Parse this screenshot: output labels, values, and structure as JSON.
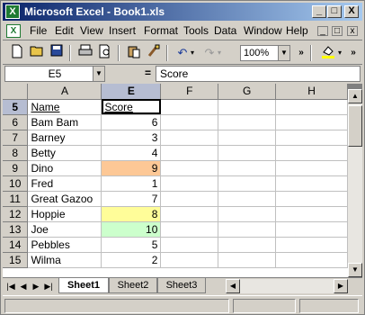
{
  "window": {
    "title": "Microsoft Excel - Book1.xls",
    "app_icon": "X",
    "controls": {
      "minimize": "_",
      "restore": "□",
      "close": "X"
    }
  },
  "menubar": {
    "items": [
      {
        "label": "File"
      },
      {
        "label": "Edit"
      },
      {
        "label": "View"
      },
      {
        "label": "Insert"
      },
      {
        "label": "Format"
      },
      {
        "label": "Tools"
      },
      {
        "label": "Data"
      },
      {
        "label": "Window"
      },
      {
        "label": "Help"
      }
    ]
  },
  "toolbar": {
    "zoom": "100%",
    "icons": [
      "new-document-icon",
      "open-folder-icon",
      "save-disk-icon",
      "print-icon",
      "print-preview-icon",
      "paste-icon",
      "format-painter-icon",
      "undo-icon",
      "redo-icon",
      "fill-color-icon"
    ]
  },
  "formula_bar": {
    "name_box": "E5",
    "equals": "=",
    "content": "Score"
  },
  "grid": {
    "columns": [
      "A",
      "E",
      "F",
      "G",
      "H"
    ],
    "rows": [
      {
        "num": "5",
        "name": "Name",
        "score": "Score",
        "header": true
      },
      {
        "num": "6",
        "name": "Bam Bam",
        "score": "6"
      },
      {
        "num": "7",
        "name": "Barney",
        "score": "3"
      },
      {
        "num": "8",
        "name": "Betty",
        "score": "4"
      },
      {
        "num": "9",
        "name": "Dino",
        "score": "9",
        "fill": "#fdc896"
      },
      {
        "num": "10",
        "name": "Fred",
        "score": "1"
      },
      {
        "num": "11",
        "name": "Great Gazoo",
        "score": "7"
      },
      {
        "num": "12",
        "name": "Hoppie",
        "score": "8",
        "fill": "#fffd99"
      },
      {
        "num": "13",
        "name": "Joe",
        "score": "10",
        "fill": "#ccffcc"
      },
      {
        "num": "14",
        "name": "Pebbles",
        "score": "5"
      },
      {
        "num": "15",
        "name": "Wilma",
        "score": "2"
      }
    ]
  },
  "sheets": {
    "tabs": [
      {
        "label": "Sheet1",
        "active": true
      },
      {
        "label": "Sheet2",
        "active": false
      },
      {
        "label": "Sheet3",
        "active": false
      }
    ]
  },
  "colors": {
    "title_gradient_start": "#0a246a",
    "title_gradient_end": "#a6caf0",
    "chrome": "#d4d0c8",
    "dino_fill": "#fdc896",
    "hoppie_fill": "#fffd99",
    "joe_fill": "#ccffcc"
  }
}
